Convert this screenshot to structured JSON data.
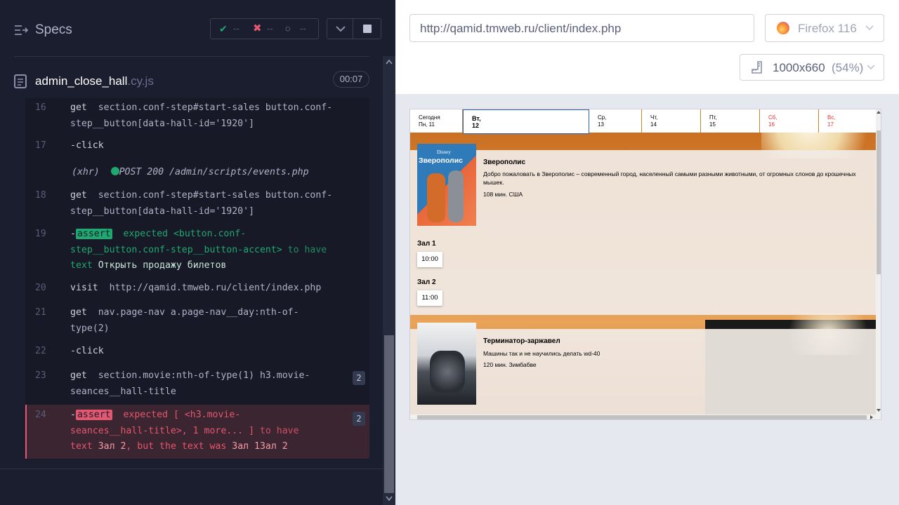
{
  "reporter": {
    "specs_label": "Specs",
    "stats": {
      "passed": "--",
      "failed": "--",
      "pending": "--"
    },
    "spec_file": {
      "name": "admin_close_hall",
      "ext": ".cy.js",
      "duration": "00:07"
    },
    "commands": [
      {
        "num": "16",
        "name": "get",
        "arg1": "section.conf-step#start-sales button.conf-",
        "arg2": "step__button[data-hall-id='1920']"
      },
      {
        "num": "17",
        "name": "-click"
      },
      {
        "xhr_label": "(xhr)",
        "xhr_text": "POST 200 /admin/scripts/events.php"
      },
      {
        "num": "18",
        "name": "get",
        "arg1": "section.conf-step#start-sales button.conf-",
        "arg2": "step__button[data-hall-id='1920']"
      },
      {
        "num": "19",
        "assert_label": "assert",
        "l1": "expected <button.conf-",
        "l2a": "step__button.conf-step__button-accent>",
        "l2b": "to have",
        "l3a": "text",
        "l3b": "Открыть продажу билетов"
      },
      {
        "num": "20",
        "name": "visit",
        "arg1": "http://qamid.tmweb.ru/client/index.php"
      },
      {
        "num": "21",
        "name": "get",
        "arg1": "nav.page-nav a.page-nav__day:nth-of-",
        "arg2": "type(2)"
      },
      {
        "num": "22",
        "name": "-click"
      },
      {
        "num": "23",
        "name": "get",
        "arg1": "section.movie:nth-of-type(1) h3.movie-",
        "arg2": "seances__hall-title",
        "badge": "2"
      },
      {
        "num": "24",
        "assert_label": "assert",
        "l1": "expected [ <h3.movie-",
        "l2a": "seances__hall-title>, 1 more... ]",
        "l2b": "to have",
        "l3a": "text",
        "l3b": "Зал 2",
        "l3c": ", but the text was",
        "l3d": "Зал 1Зал 2",
        "badge": "2"
      }
    ]
  },
  "browser": {
    "url": "http://qamid.tmweb.ru/client/index.php",
    "name": "Firefox 116",
    "viewport": "1000x660",
    "zoom": "(54%)"
  },
  "app": {
    "days": [
      {
        "l1": "Сегодня",
        "l2": "Пн, 11"
      },
      {
        "l1": "Вт,",
        "l2": "12"
      },
      {
        "l1": "Ср,",
        "l2": "13"
      },
      {
        "l1": "Чт,",
        "l2": "14"
      },
      {
        "l1": "Пт,",
        "l2": "15"
      },
      {
        "l1": "Сб,",
        "l2": "16"
      },
      {
        "l1": "Вс,",
        "l2": "17"
      }
    ],
    "movies": [
      {
        "title": "Зверополис",
        "desc": "Добро пожаловать в Зверополис – современный город, населенный самыми разными животными, от огромных слонов до крошечных мышек.",
        "meta": "108 мин. США",
        "poster_text": "Зверополис",
        "poster_brand": "Disney",
        "halls": [
          {
            "name": "Зал 1",
            "time": "10:00"
          },
          {
            "name": "Зал 2",
            "time": "11:00"
          }
        ]
      },
      {
        "title": "Терминатор-заржавел",
        "desc": "Машины так и не научились делать wd-40",
        "meta": "120 мин. Зимбабве"
      }
    ]
  }
}
